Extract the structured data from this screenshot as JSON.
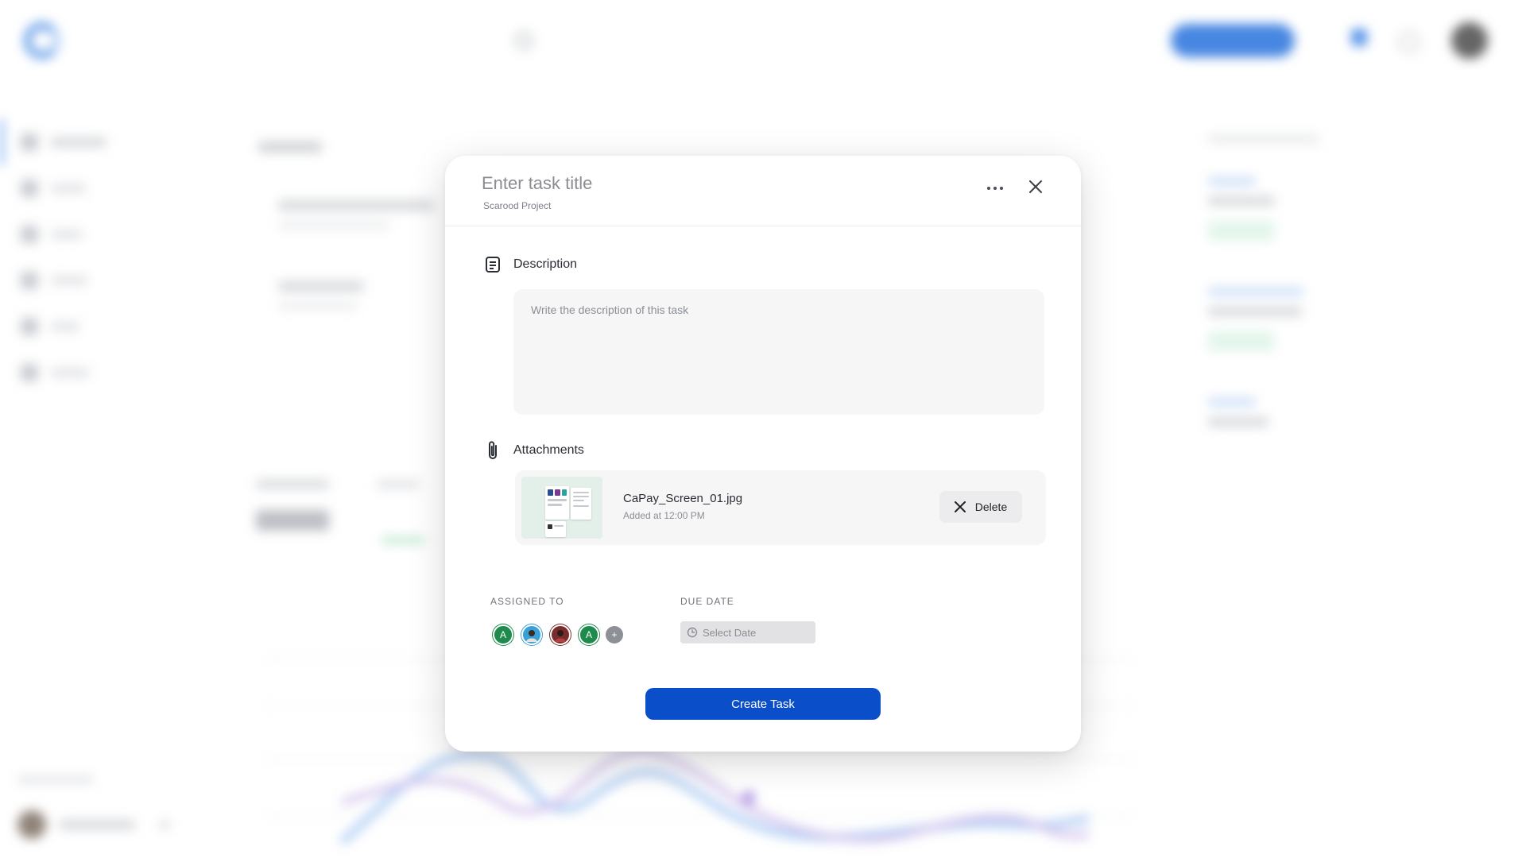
{
  "modal": {
    "title_placeholder": "Enter task title",
    "project": "Scarood Project",
    "description": {
      "label": "Description",
      "placeholder": "Write the description of this task",
      "value": ""
    },
    "attachments": {
      "label": "Attachments",
      "items": [
        {
          "file_name": "CaPay_Screen_01.jpg",
          "meta": "Added at 12:00 PM",
          "delete_label": "Delete"
        }
      ]
    },
    "assigned_to": {
      "label": "ASSIGNED TO",
      "assignees": [
        {
          "initial": "A",
          "color": "#1e8a4c"
        },
        {
          "initial": "",
          "color": "#3aa0d8"
        },
        {
          "initial": "",
          "color": "#7a2b2b"
        },
        {
          "initial": "A",
          "color": "#1e8a4c"
        }
      ],
      "add_label": "+"
    },
    "due_date": {
      "label": "DUE DATE",
      "placeholder": "Select Date"
    },
    "submit_label": "Create Task"
  },
  "colors": {
    "primary": "#0a4fc9",
    "panel": "#f6f6f7",
    "success": "#22a85b"
  },
  "icons": {
    "more": "more-horizontal-icon",
    "close": "close-icon",
    "description": "document-icon",
    "attachments": "paperclip-icon",
    "delete": "close-icon",
    "date": "clock-icon"
  }
}
